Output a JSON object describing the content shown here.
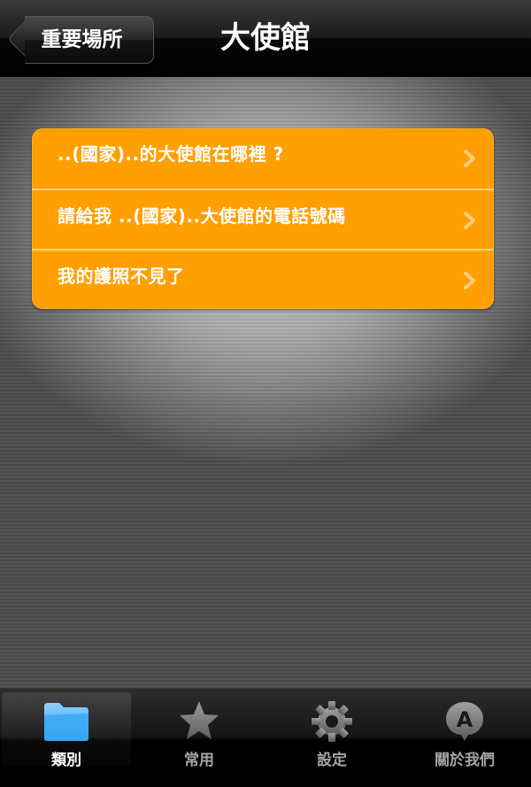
{
  "navbar": {
    "back_label": "重要場所",
    "title": "大使館"
  },
  "menu": {
    "items": [
      {
        "label": "..(國家)..的大使館在哪裡 ?"
      },
      {
        "label": "請給我 ..(國家)..大使館的電話號碼"
      },
      {
        "label": "我的護照不見了"
      }
    ]
  },
  "tabbar": {
    "tabs": [
      {
        "label": "類別",
        "icon": "folder-icon",
        "selected": true
      },
      {
        "label": "常用",
        "icon": "star-icon",
        "selected": false
      },
      {
        "label": "設定",
        "icon": "gear-icon",
        "selected": false
      },
      {
        "label": "關於我們",
        "icon": "about-icon",
        "selected": false
      }
    ]
  },
  "colors": {
    "accent": "#FF9F00",
    "selected_tab_icon": "#3AA9F5"
  }
}
